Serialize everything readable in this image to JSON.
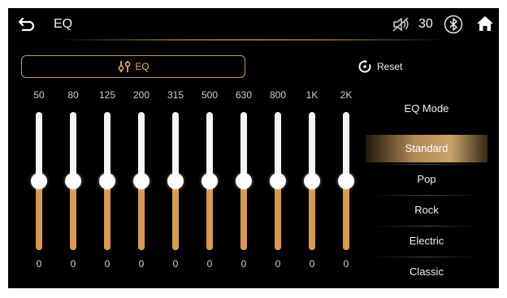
{
  "header": {
    "title": "EQ",
    "volume": "30"
  },
  "icons": {
    "back": "back-arrow-icon",
    "mute": "volume-mute-icon",
    "bluetooth": "bluetooth-icon",
    "home": "home-icon",
    "eq": "equalizer-icon",
    "reset": "reset-icon"
  },
  "tabs": {
    "eq_label": "EQ"
  },
  "reset": {
    "label": "Reset"
  },
  "bands": [
    {
      "freq": "50",
      "value": "0",
      "level": 0.5
    },
    {
      "freq": "80",
      "value": "0",
      "level": 0.5
    },
    {
      "freq": "125",
      "value": "0",
      "level": 0.5
    },
    {
      "freq": "200",
      "value": "0",
      "level": 0.5
    },
    {
      "freq": "315",
      "value": "0",
      "level": 0.5
    },
    {
      "freq": "500",
      "value": "0",
      "level": 0.5
    },
    {
      "freq": "630",
      "value": "0",
      "level": 0.5
    },
    {
      "freq": "800",
      "value": "0",
      "level": 0.5
    },
    {
      "freq": "1K",
      "value": "0",
      "level": 0.5
    },
    {
      "freq": "2K",
      "value": "0",
      "level": 0.5
    }
  ],
  "modes": {
    "title": "EQ Mode",
    "selected": "Standard",
    "items": [
      "Standard",
      "Pop",
      "Rock",
      "Electric",
      "Classic"
    ]
  },
  "colors": {
    "accent": "#d79a4e",
    "accent_border": "#b8976a",
    "background": "#000000"
  }
}
